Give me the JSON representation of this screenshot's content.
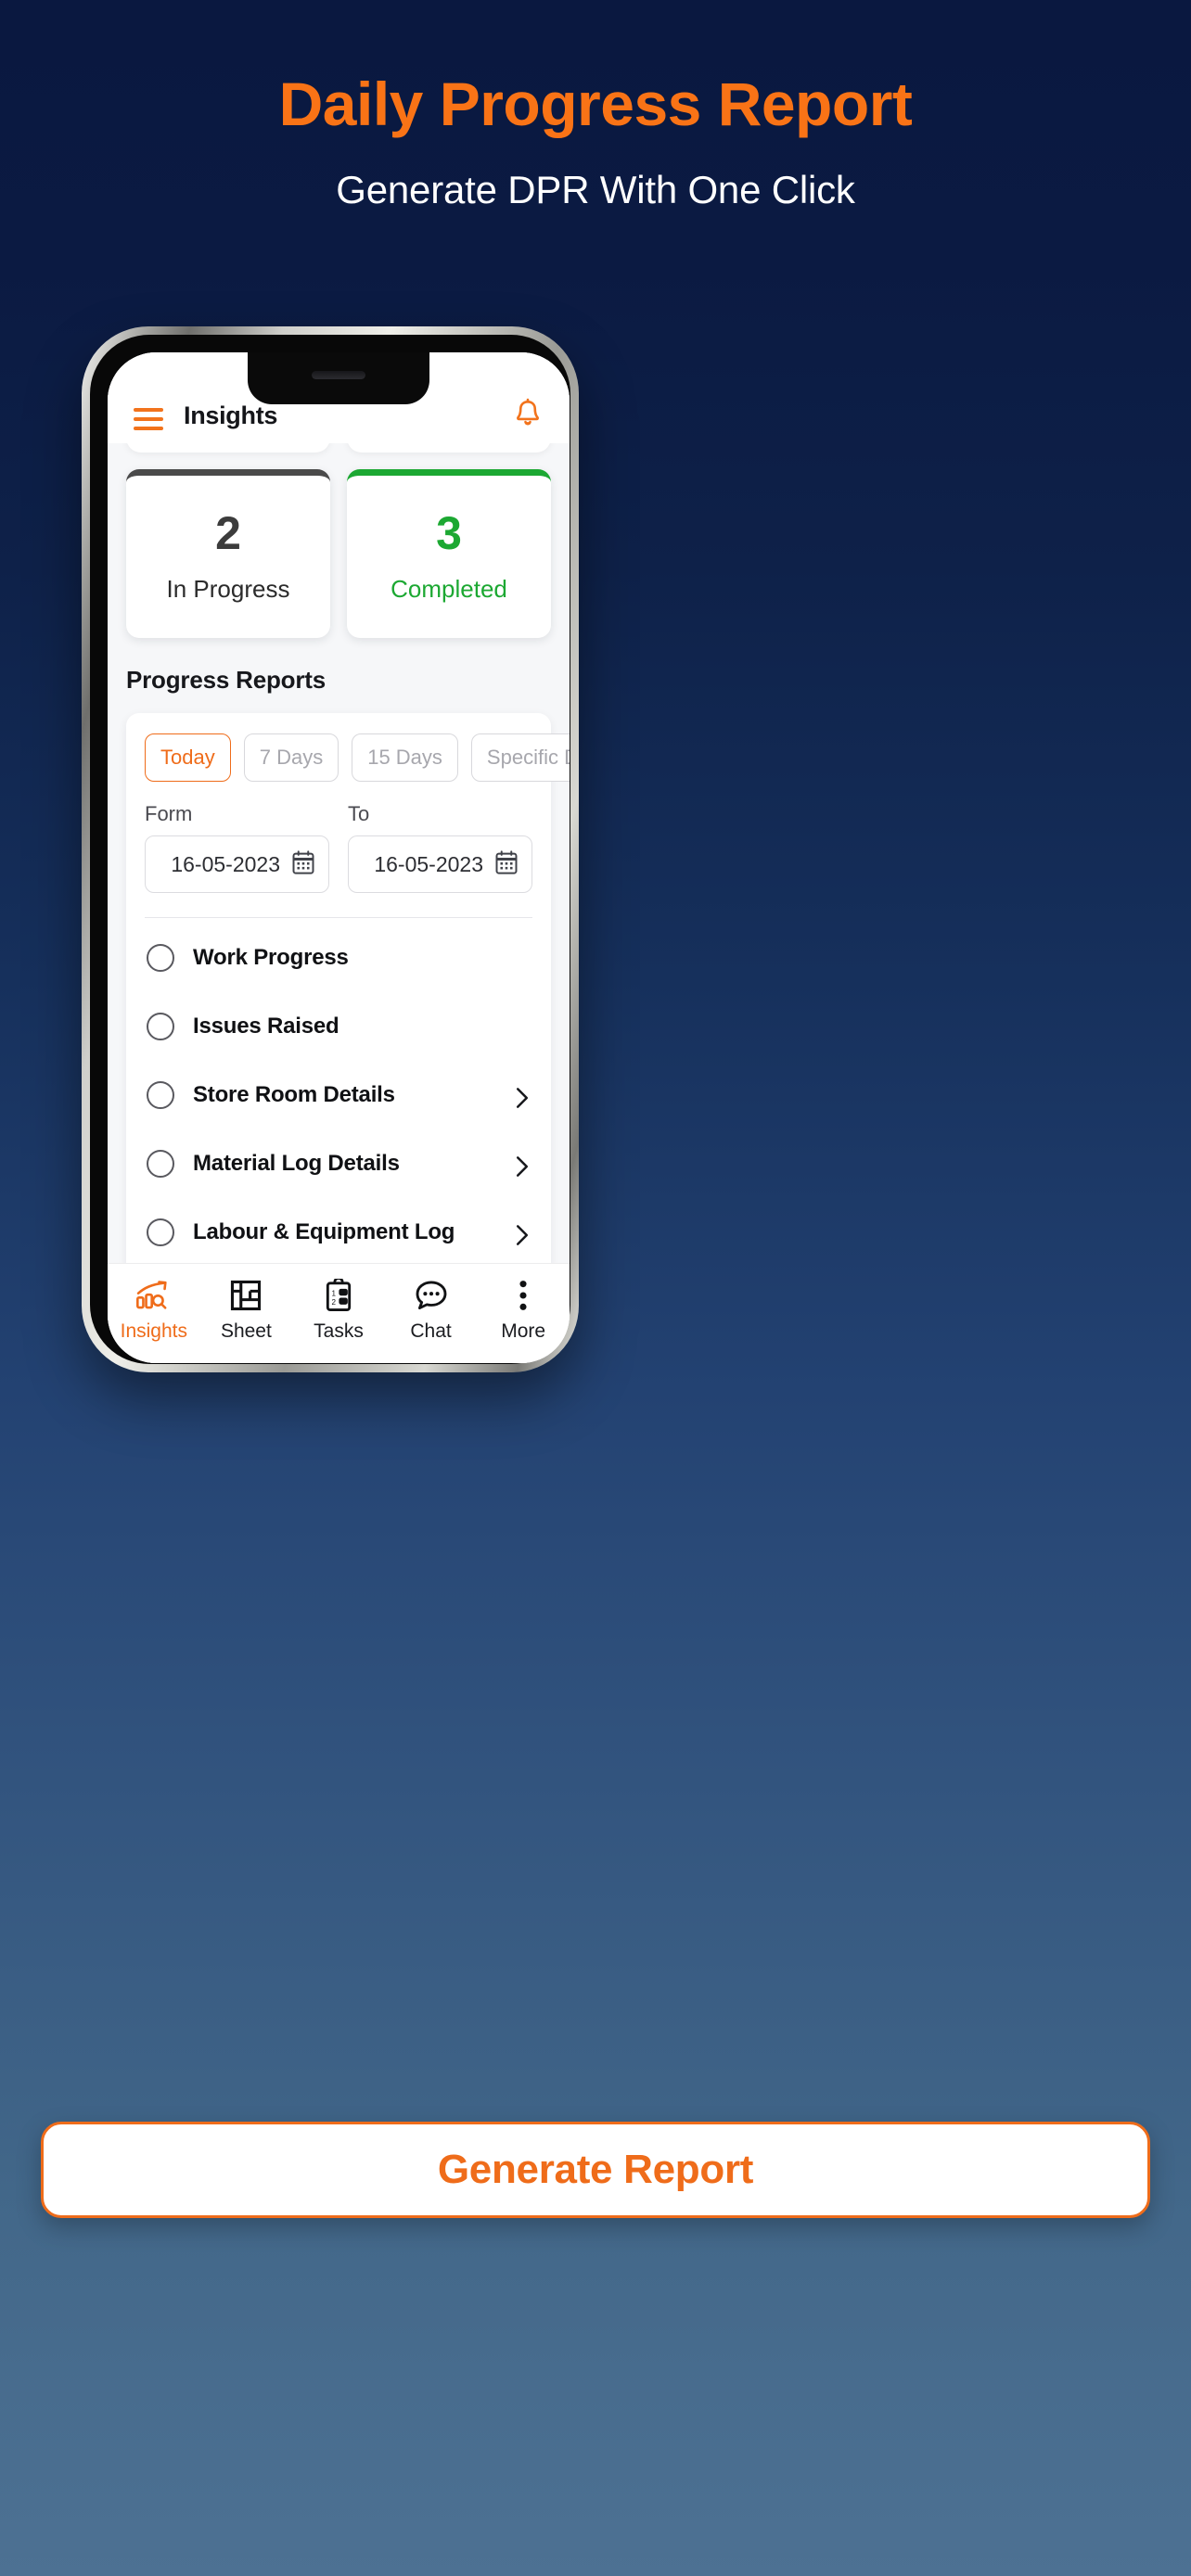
{
  "promo": {
    "title": "Daily Progress Report",
    "subtitle": "Generate DPR With One Click",
    "title_color": "#f97316"
  },
  "app": {
    "appbar": {
      "menu_icon": "hamburger-icon",
      "title": "Insights",
      "notification_icon": "bell-icon"
    },
    "stats": [
      {
        "value": "2",
        "label": "In Progress",
        "accent": "#4a4a4a"
      },
      {
        "value": "3",
        "label": "Completed",
        "accent": "#1ca832"
      }
    ],
    "section_title": "Progress Reports",
    "filters": {
      "chips": [
        {
          "label": "Today",
          "active": true
        },
        {
          "label": "7 Days",
          "active": false
        },
        {
          "label": "15 Days",
          "active": false
        },
        {
          "label": "Specific Date",
          "active": false
        }
      ],
      "date_from": {
        "label": "Form",
        "value": "16-05-2023",
        "icon": "calendar-icon"
      },
      "date_to": {
        "label": "To",
        "value": "16-05-2023",
        "icon": "calendar-icon"
      }
    },
    "options": [
      {
        "label": "Work Progress",
        "chevron": false
      },
      {
        "label": "Issues Raised",
        "chevron": false
      },
      {
        "label": "Store Room Details",
        "chevron": true
      },
      {
        "label": "Material Log Details",
        "chevron": true
      },
      {
        "label": "Labour & Equipment Log",
        "chevron": true
      }
    ],
    "bottom_nav": [
      {
        "label": "Insights",
        "icon": "bar-chart-trend-icon",
        "active": true
      },
      {
        "label": "Sheet",
        "icon": "floor-plan-icon",
        "active": false
      },
      {
        "label": "Tasks",
        "icon": "clipboard-list-icon",
        "active": false
      },
      {
        "label": "Chat",
        "icon": "chat-bubble-icon",
        "active": false
      },
      {
        "label": "More",
        "icon": "dots-vertical-icon",
        "active": false
      }
    ]
  },
  "cta": {
    "label": "Generate Report",
    "color": "#ef6c1a"
  }
}
